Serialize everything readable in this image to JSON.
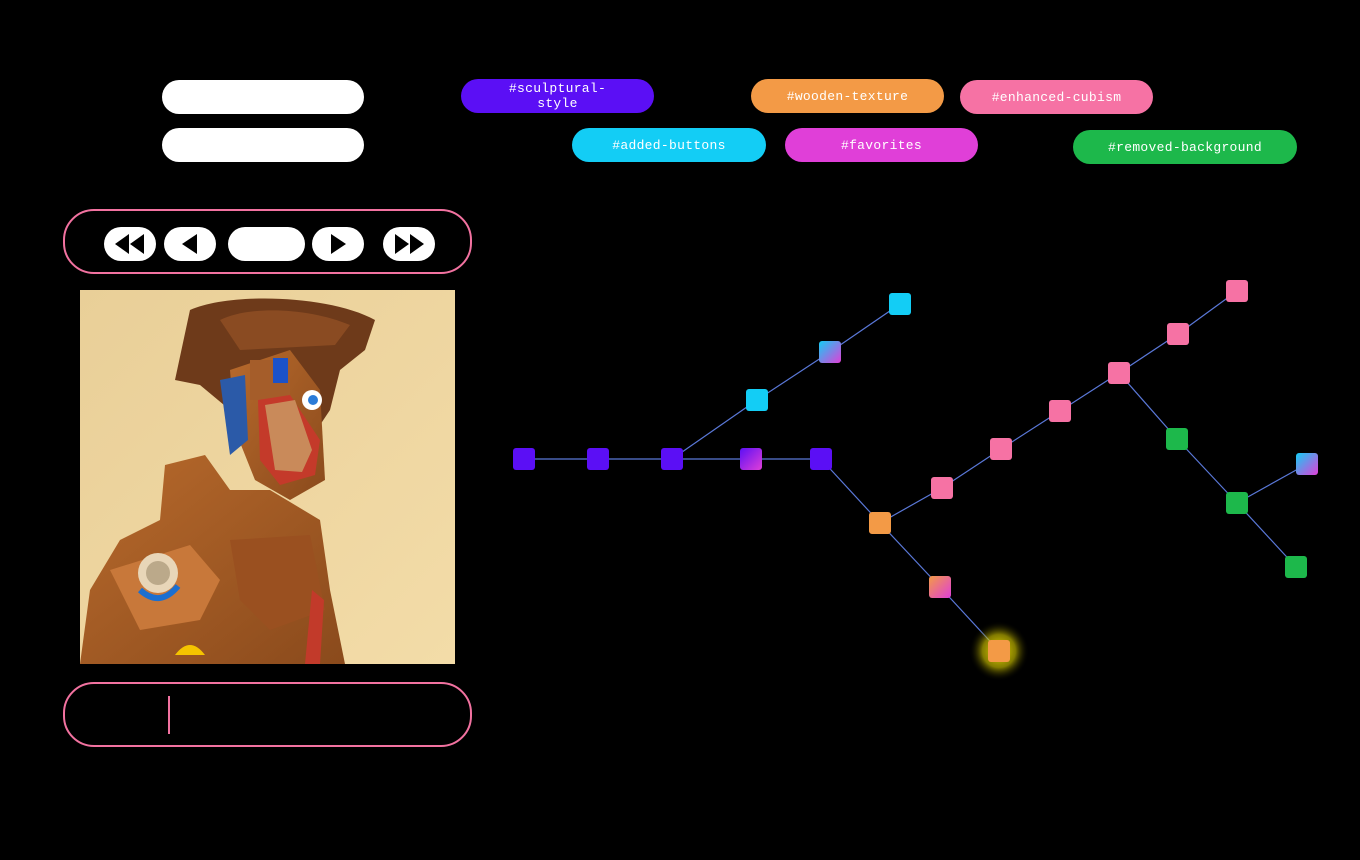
{
  "top_inputs": [
    {
      "name": "filter-input-1",
      "value": ""
    },
    {
      "name": "filter-input-2",
      "value": ""
    }
  ],
  "tags": [
    {
      "label": "#sculptural-\nstyle",
      "color": "#5b0ff5"
    },
    {
      "label": "#wooden-texture",
      "color": "#f39a46"
    },
    {
      "label": "#enhanced-cubism",
      "color": "#f672a4"
    },
    {
      "label": "#added-buttons",
      "color": "#13cdf5"
    },
    {
      "label": "#favorites",
      "color": "#e03fd8"
    },
    {
      "label": "#removed-background",
      "color": "#1db84b"
    }
  ],
  "player": {
    "center_label": "",
    "icons": [
      "rewind-icon",
      "step-back-icon",
      "play-icon",
      "fast-forward-icon"
    ]
  },
  "prompt": {
    "value": ""
  },
  "graph": {
    "edge_color": "#5a78d8",
    "selected_node": "n20",
    "nodes": [
      {
        "id": "n1",
        "colors": [
          "#5b0ff5"
        ]
      },
      {
        "id": "n2",
        "colors": [
          "#5b0ff5"
        ]
      },
      {
        "id": "n3",
        "colors": [
          "#5b0ff5"
        ]
      },
      {
        "id": "n4",
        "colors": [
          "#5b0ff5",
          "#e03fd8"
        ]
      },
      {
        "id": "n5",
        "colors": [
          "#5b0ff5"
        ]
      },
      {
        "id": "n6",
        "colors": [
          "#13cdf5"
        ]
      },
      {
        "id": "n7",
        "colors": [
          "#13cdf5",
          "#e03fd8"
        ]
      },
      {
        "id": "n8",
        "colors": [
          "#13cdf5"
        ]
      },
      {
        "id": "n9",
        "colors": [
          "#f39a46"
        ]
      },
      {
        "id": "n10",
        "colors": [
          "#f672a4"
        ]
      },
      {
        "id": "n11",
        "colors": [
          "#f672a4"
        ]
      },
      {
        "id": "n12",
        "colors": [
          "#f672a4"
        ]
      },
      {
        "id": "n13",
        "colors": [
          "#f672a4"
        ]
      },
      {
        "id": "n14",
        "colors": [
          "#f672a4"
        ]
      },
      {
        "id": "n15",
        "colors": [
          "#f672a4"
        ]
      },
      {
        "id": "n16",
        "colors": [
          "#1db84b"
        ]
      },
      {
        "id": "n17",
        "colors": [
          "#1db84b"
        ]
      },
      {
        "id": "n18",
        "colors": [
          "#13cdf5",
          "#e03fd8"
        ]
      },
      {
        "id": "n19",
        "colors": [
          "#1db84b"
        ]
      },
      {
        "id": "n20",
        "colors": [
          "#f39a46"
        ]
      },
      {
        "id": "n21",
        "colors": [
          "#f39a46",
          "#e03fd8"
        ]
      }
    ],
    "edges": [
      [
        "n1",
        "n2"
      ],
      [
        "n2",
        "n3"
      ],
      [
        "n3",
        "n4"
      ],
      [
        "n4",
        "n5"
      ],
      [
        "n3",
        "n6"
      ],
      [
        "n6",
        "n7"
      ],
      [
        "n7",
        "n8"
      ],
      [
        "n5",
        "n9"
      ],
      [
        "n9",
        "n21"
      ],
      [
        "n21",
        "n20"
      ],
      [
        "n9",
        "n10"
      ],
      [
        "n10",
        "n11"
      ],
      [
        "n11",
        "n12"
      ],
      [
        "n12",
        "n13"
      ],
      [
        "n13",
        "n14"
      ],
      [
        "n14",
        "n15"
      ],
      [
        "n13",
        "n16"
      ],
      [
        "n16",
        "n17"
      ],
      [
        "n17",
        "n18"
      ],
      [
        "n17",
        "n19"
      ]
    ]
  }
}
